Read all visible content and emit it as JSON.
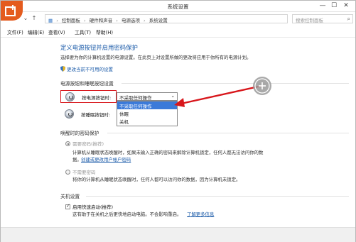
{
  "window": {
    "title": "系统设置"
  },
  "titlebar": {
    "minimize": "—",
    "maximize": "☐",
    "close": "✕"
  },
  "address": {
    "crumbs": [
      "控制面板",
      "硬件和声音",
      "电源选项",
      "系统设置"
    ],
    "search_placeholder": "搜索控制面板"
  },
  "menu": [
    "文件(F)",
    "编辑(E)",
    "查看(V)",
    "工具(T)",
    "帮助(H)"
  ],
  "page": {
    "heading": "定义电源按钮并启用密码保护",
    "description": "选择要为你的计算机设置的电源设置。在此页上对设置所做的更改将应用于你所有的电源计划。",
    "change_unavailable": "更改当前不可用的设置",
    "power_section_title": "电源按钮和睡眠按钮设置",
    "power_button_label": "按电源按钮时:",
    "sleep_button_label": "按睡眠按钮时:",
    "power_select_value": "不采取任何操作",
    "dropdown_options": [
      "不采取任何操作",
      "休眠",
      "关机"
    ],
    "wakeup_section_title": "唤醒时的密码保护",
    "require_password": "需要密码(推荐)",
    "require_password_desc": "计算机从睡眠状态唤醒时，如果未输入正确的密码来解除计算机锁定，任何人都无法访问你的数",
    "require_password_desc2": "据。",
    "create_password_link": "创建或更改用户帐户密码",
    "no_password": "不需要密码",
    "no_password_desc": "将你的计算机从睡眠状态唤醒时，任何人都可以访问你的数据，因为计算机未锁定。",
    "shutdown_section_title": "关机设置",
    "fast_startup": "启用快速启动(推荐)",
    "fast_startup_desc": "这有助于在关机之后更快地启动电脑。不会影响重启。",
    "learn_more": "了解更多信息"
  },
  "colors": {
    "accent": "#1a5aa8",
    "highlight_red": "#d8161b",
    "brand_orange": "#e45b1e"
  }
}
